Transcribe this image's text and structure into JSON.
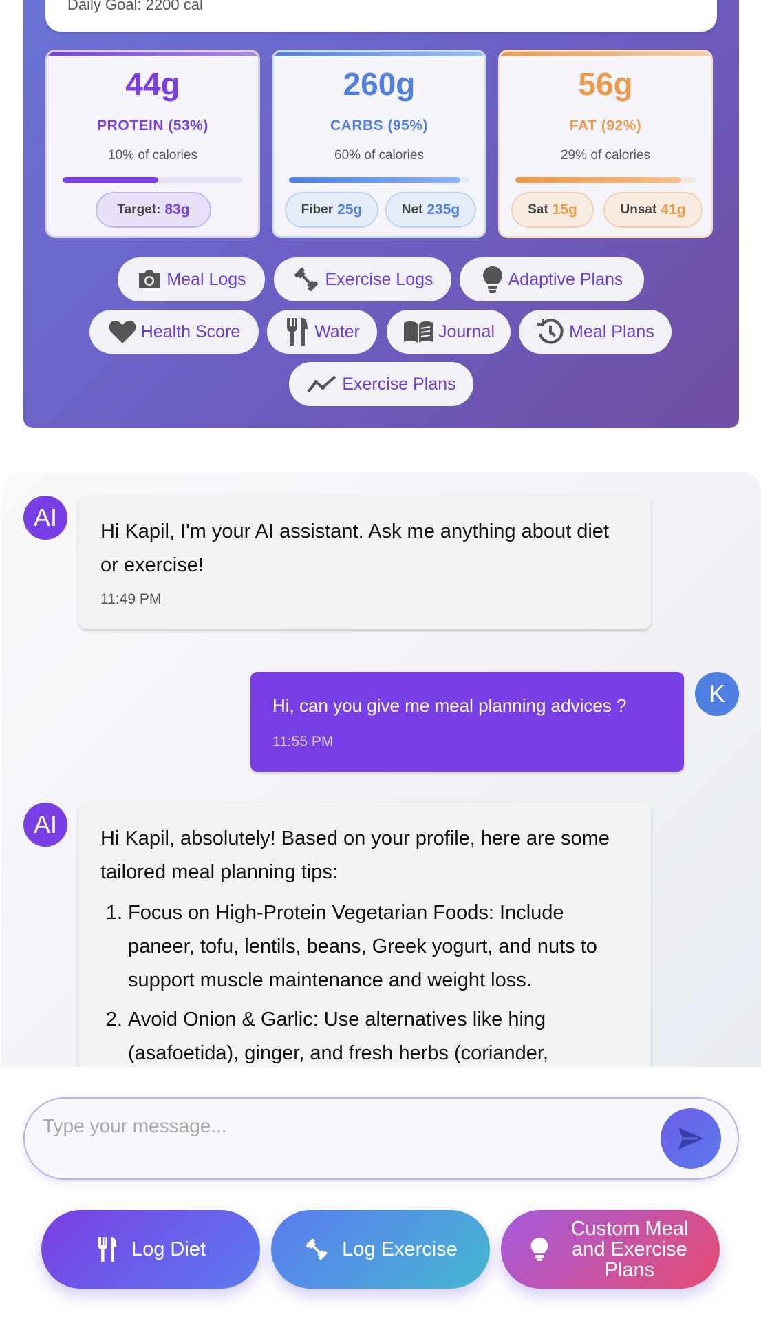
{
  "header": {
    "daily_goal": "Daily Goal: 2200 cal"
  },
  "macros": [
    {
      "value": "44g",
      "label": "PROTEIN (53%)",
      "sub": "10% of calories",
      "progress": 0.53,
      "color": "#7a3fe4"
    },
    {
      "value": "260g",
      "label": "CARBS (95%)",
      "sub": "60% of calories",
      "progress": 0.95,
      "color": "#4f7fe0"
    },
    {
      "value": "56g",
      "label": "FAT (92%)",
      "sub": "29% of calories",
      "progress": 0.92,
      "color": "#ec9a4a"
    }
  ],
  "macro_pills": {
    "protein_target_label": "Target:",
    "protein_target_value": "83g",
    "fiber_label": "Fiber",
    "fiber_value": "25g",
    "net_label": "Net",
    "net_value": "235g",
    "sat_label": "Sat",
    "sat_value": "15g",
    "unsat_label": "Unsat",
    "unsat_value": "41g"
  },
  "nav": {
    "meal_logs": "Meal Logs",
    "exercise_logs": "Exercise Logs",
    "adaptive_plans": "Adaptive Plans",
    "health_score": "Health Score",
    "water": "Water",
    "journal": "Journal",
    "meal_plans": "Meal Plans",
    "exercise_plans": "Exercise Plans"
  },
  "chat": {
    "ai_avatar": "AI",
    "user_avatar": "K",
    "messages": [
      {
        "text": "Hi Kapil, I'm your AI assistant. Ask me anything about diet or exercise!",
        "time": "11:49 PM"
      },
      {
        "text": "Hi, can you give me meal planning advices ?",
        "time": "11:55 PM"
      },
      {
        "text": "Hi Kapil, absolutely! Based on your profile, here are some tailored meal planning tips:",
        "items": [
          "Focus on High-Protein Vegetarian Foods: Include paneer, tofu, lentils, beans, Greek yogurt, and nuts to support muscle maintenance and weight loss.",
          "Avoid Onion & Garlic: Use alternatives like hing (asafoetida), ginger, and fresh herbs (coriander,"
        ]
      }
    ]
  },
  "input": {
    "placeholder": "Type your message..."
  },
  "actions": {
    "log_diet": "Log Diet",
    "log_exercise": "Log Exercise",
    "custom_plans": "Custom Meal and Exercise Plans"
  },
  "colors": {
    "accent": "#7a3fe4",
    "carbs": "#4f7fe0",
    "fat": "#ec9a4a",
    "user_avatar": "#4f7fe0"
  }
}
